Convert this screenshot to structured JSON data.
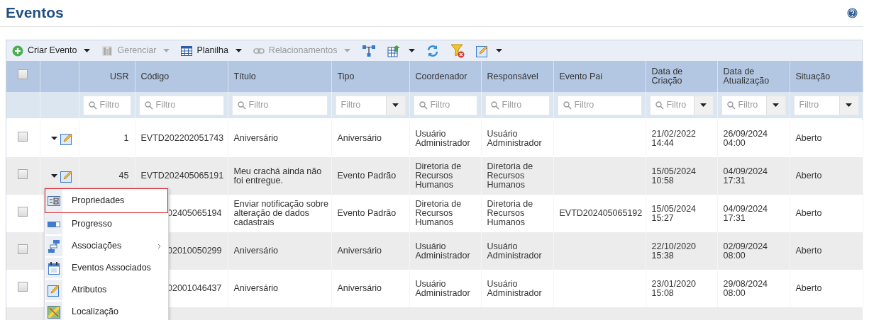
{
  "page": {
    "title": "Eventos"
  },
  "toolbar": [
    {
      "kind": "create",
      "label": "Criar Evento",
      "disabled": false,
      "dropdown": true
    },
    {
      "kind": "manage",
      "label": "Gerenciar",
      "disabled": true,
      "dropdown": true
    },
    {
      "kind": "sheet",
      "label": "Planilha",
      "disabled": false,
      "dropdown": true
    },
    {
      "kind": "link",
      "label": "Relacionamentos",
      "disabled": true,
      "dropdown": true
    },
    {
      "kind": "hierarchy",
      "dropdown": false
    },
    {
      "kind": "export",
      "dropdown": true
    },
    {
      "kind": "refresh",
      "dropdown": false
    },
    {
      "kind": "clear-filter",
      "dropdown": false
    },
    {
      "kind": "edit",
      "dropdown": true
    }
  ],
  "table": {
    "select_all": {
      "checked": false
    },
    "columns": [
      {
        "label": "USR",
        "filter": {
          "placeholder": "Filtro",
          "search": true,
          "dropdown": false
        }
      },
      {
        "label": "Código",
        "filter": {
          "placeholder": "Filtro",
          "search": true,
          "dropdown": false
        }
      },
      {
        "label": "Título",
        "filter": {
          "placeholder": "Filtro",
          "search": true,
          "dropdown": false
        }
      },
      {
        "label": "Tipo",
        "filter": {
          "placeholder": "Filtro",
          "search": false,
          "dropdown": true
        }
      },
      {
        "label": "Coordenador",
        "filter": {
          "placeholder": "Filtro",
          "search": true,
          "dropdown": false
        }
      },
      {
        "label": "Responsável",
        "filter": {
          "placeholder": "Filtro",
          "search": true,
          "dropdown": false
        }
      },
      {
        "label": "Evento Pai",
        "filter": {
          "placeholder": "Filtro",
          "search": true,
          "dropdown": false
        }
      },
      {
        "label": "Data de Criação",
        "filter": {
          "placeholder": "Filtro",
          "search": true,
          "dropdown": true
        }
      },
      {
        "label": "Data de\nAtualização",
        "filter": {
          "placeholder": "Filtro",
          "search": true,
          "dropdown": true
        }
      },
      {
        "label": "Situação",
        "filter": {
          "placeholder": "Filtro",
          "search": false,
          "dropdown": true
        }
      }
    ],
    "rows": [
      {
        "checked": false,
        "actions": true,
        "cells": [
          "1",
          "EVTD202202051743",
          "Aniversário",
          "Aniversário",
          "Usuário\nAdministrador",
          "Usuário\nAdministrador",
          "",
          "21/02/2022\n14:44",
          "26/09/2024\n04:00",
          "Aberto"
        ]
      },
      {
        "checked": false,
        "actions": true,
        "cells": [
          "45",
          "EVTD202405065191",
          "Meu crachá ainda não\nfoi entregue.",
          "Evento Padrão",
          "Diretoria de\nRecursos\nHumanos",
          "Diretoria de\nRecursos\nHumanos",
          "",
          "15/05/2024\n10:58",
          "04/09/2024\n17:31",
          "Aberto"
        ],
        "menu": [
          {
            "kind": "properties",
            "label": "Propriedades",
            "selected": true,
            "submenu": false
          },
          {
            "kind": "progress",
            "label": "Progresso",
            "selected": false,
            "submenu": false
          },
          {
            "kind": "associations",
            "label": "Associações",
            "selected": false,
            "submenu": true
          },
          {
            "kind": "calendar",
            "label": "Eventos Associados",
            "selected": false,
            "submenu": false
          },
          {
            "kind": "attributes",
            "label": "Atributos",
            "selected": false,
            "submenu": false
          },
          {
            "kind": "location",
            "label": "Localização",
            "selected": false,
            "submenu": false
          }
        ]
      },
      {
        "checked": false,
        "actions": false,
        "cells": [
          "",
          "02405065194",
          "Enviar notificação sobre\nalteração de dados\ncadastrais",
          "Evento Padrão",
          "Diretoria de\nRecursos\nHumanos",
          "Diretoria de\nRecursos\nHumanos",
          "EVTD202405065192",
          "15/05/2024\n15:27",
          "04/09/2024\n17:31",
          "Aberto"
        ]
      },
      {
        "checked": false,
        "actions": false,
        "cells": [
          "",
          "02010050299",
          "Aniversário",
          "Aniversário",
          "Usuário\nAdministrador",
          "Usuário\nAdministrador",
          "",
          "22/10/2020\n15:38",
          "02/09/2024\n08:00",
          "Aberto"
        ]
      },
      {
        "checked": false,
        "actions": false,
        "cells": [
          "",
          "02001046437",
          "Aniversário",
          "Aniversário",
          "Usuário\nAdministrador",
          "Usuário\nAdministrador",
          "",
          "23/01/2020\n15:08",
          "29/08/2024\n08:00",
          "Aberto"
        ]
      }
    ]
  }
}
